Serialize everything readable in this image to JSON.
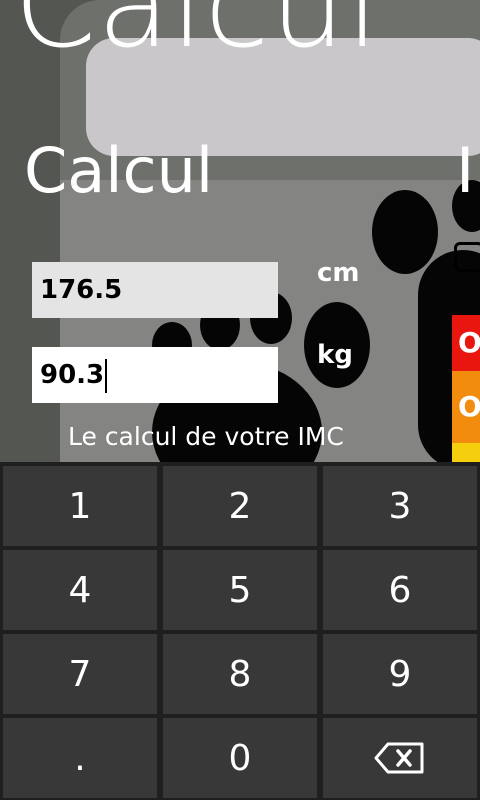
{
  "app": {
    "title": "Calcul",
    "section_title": "Calcul",
    "section_title_next": "I"
  },
  "inputs": {
    "height": {
      "value": "176.5",
      "unit": "cm"
    },
    "weight": {
      "value": "90.3",
      "unit": "kg"
    }
  },
  "result_label": "Le calcul de votre IMC",
  "categories": [
    {
      "label": "O",
      "color": "#e8160f"
    },
    {
      "label": "O",
      "color": "#f28c0f"
    },
    {
      "label": "",
      "color": "#f5cf0d"
    }
  ],
  "keypad": {
    "keys": [
      "1",
      "2",
      "3",
      "4",
      "5",
      "6",
      "7",
      "8",
      "9",
      ".",
      "0"
    ],
    "backspace_icon": "backspace-icon"
  }
}
